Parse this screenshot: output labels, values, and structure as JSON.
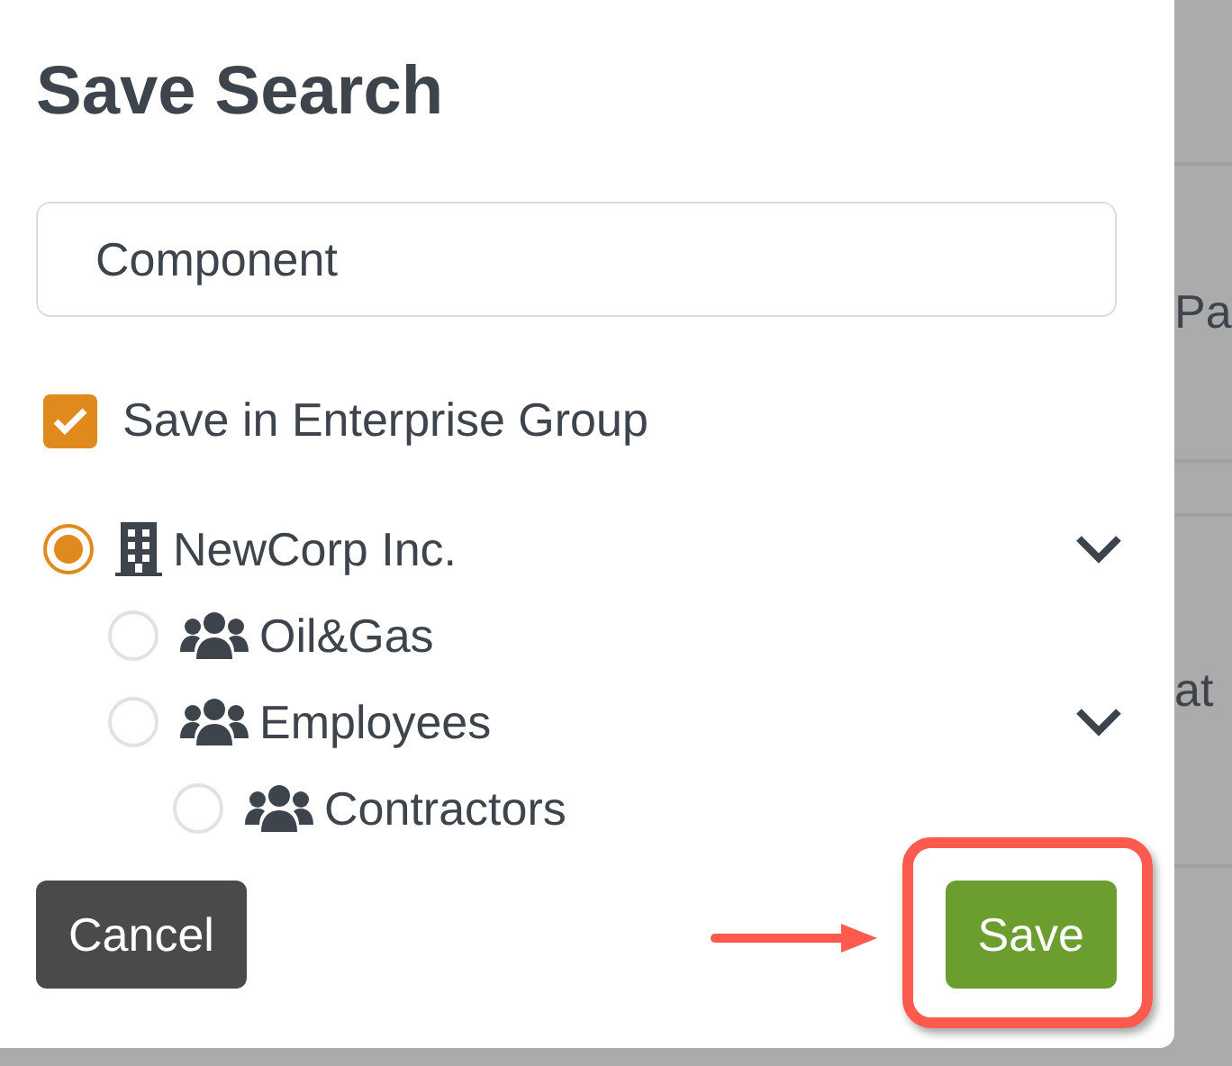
{
  "dialog": {
    "title": "Save Search",
    "name_field": {
      "value": "Component"
    },
    "enterprise_checkbox": {
      "label": "Save in Enterprise Group",
      "checked": true
    },
    "tree": [
      {
        "label": "NewCorp Inc.",
        "kind": "building",
        "selected": true,
        "expanded": true,
        "children": [
          {
            "label": "Oil&Gas",
            "kind": "group",
            "selected": false
          },
          {
            "label": "Employees",
            "kind": "group",
            "selected": false,
            "expanded": true,
            "children": [
              {
                "label": "Contractors",
                "kind": "group",
                "selected": false
              }
            ]
          }
        ]
      }
    ],
    "buttons": [
      {
        "label": "Cancel",
        "kind": "secondary"
      },
      {
        "label": "Save",
        "kind": "primary"
      }
    ]
  },
  "background": {
    "fragments": [
      "Pa",
      "at"
    ]
  }
}
